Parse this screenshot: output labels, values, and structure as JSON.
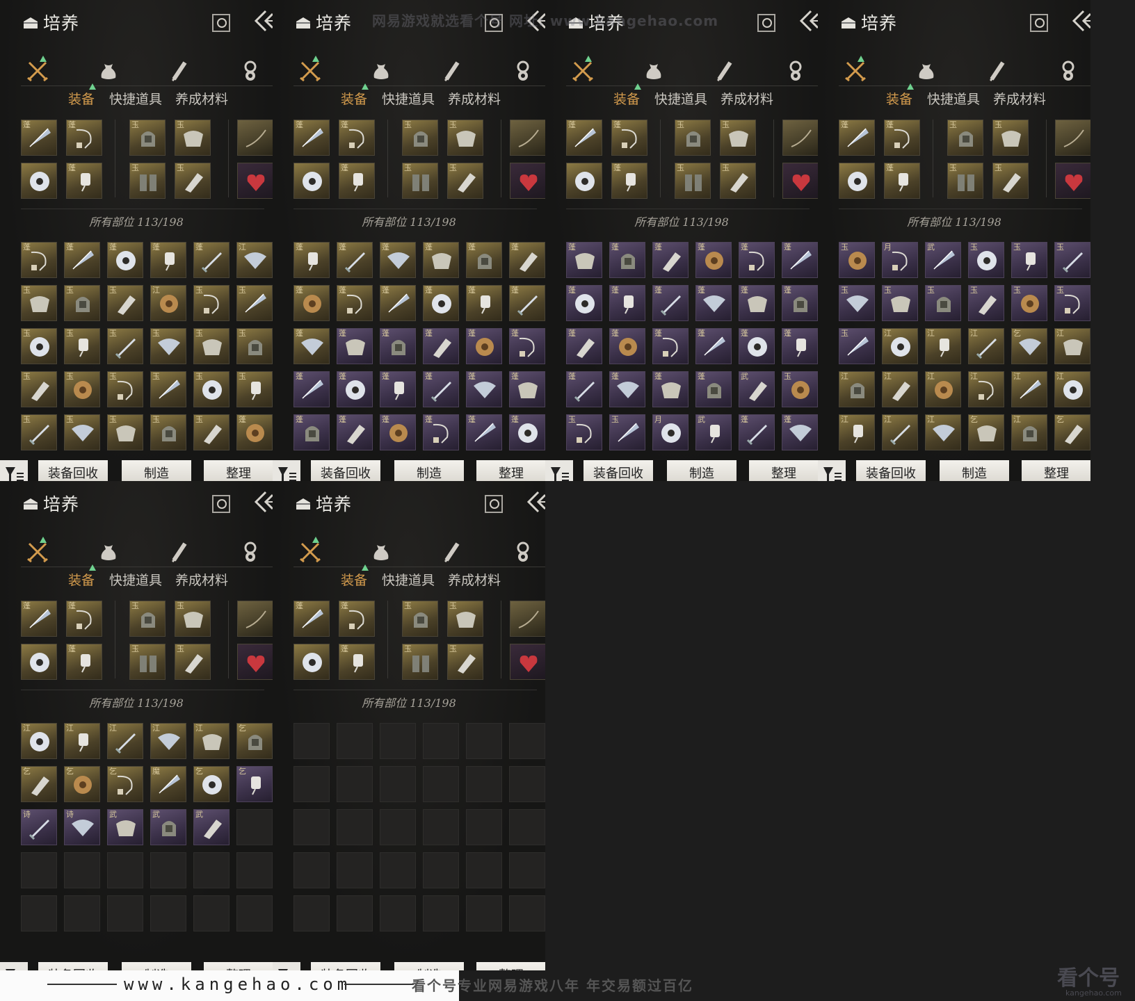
{
  "panel_title": "培养",
  "tabs": [
    {
      "label": "装备",
      "active": true
    },
    {
      "label": "快捷道具",
      "active": false
    },
    {
      "label": "养成材料",
      "active": false
    }
  ],
  "category_icons": [
    "crossed-swords-icon",
    "pouch-icon",
    "scroll-icon",
    "gem-icon"
  ],
  "equipped_slots": [
    {
      "badge": "蓬",
      "item": "umbrella"
    },
    {
      "badge": "蓬",
      "item": "pendant"
    },
    {
      "badge": "玉",
      "item": "helmet"
    },
    {
      "badge": "玉",
      "item": "armor"
    },
    {
      "badge": "",
      "item": "bow"
    },
    {
      "badge": "",
      "item": "ring"
    },
    {
      "badge": "蓬",
      "item": "charm"
    },
    {
      "badge": "玉",
      "item": "greaves"
    },
    {
      "badge": "玉",
      "item": "bracer"
    },
    {
      "badge": "",
      "item": "heart"
    }
  ],
  "count_label": "所有部位 113/198",
  "buttons": {
    "recycle": "装备回收",
    "craft": "制造",
    "sort": "整理"
  },
  "panels": [
    {
      "grid": [
        "g",
        "g",
        "g",
        "g",
        "g",
        "g",
        "g",
        "g",
        "g",
        "g",
        "g",
        "g",
        "g",
        "g",
        "g",
        "g",
        "g",
        "g",
        "g",
        "g",
        "g",
        "g",
        "g",
        "g",
        "g",
        "g",
        "g",
        "g",
        "g",
        "g"
      ],
      "badges": "蓬蓬蓬蓬蓬江玉玉玉江玉玉玉玉玉玉玉玉玉玉玉玉玉玉玉玉玉玉玉蓬"
    },
    {
      "grid": [
        "g",
        "g",
        "g",
        "g",
        "g",
        "g",
        "g",
        "g",
        "g",
        "g",
        "g",
        "g",
        "g",
        "p",
        "p",
        "p",
        "p",
        "p",
        "p",
        "p",
        "p",
        "p",
        "p",
        "p",
        "p",
        "p",
        "p",
        "p",
        "p",
        "p"
      ],
      "badges": "蓬蓬蓬蓬蓬蓬蓬蓬蓬蓬蓬蓬蓬蓬蓬蓬蓬蓬蓬蓬蓬蓬蓬蓬蓬蓬蓬蓬蓬蓬"
    },
    {
      "grid": [
        "p",
        "p",
        "p",
        "p",
        "p",
        "p",
        "p",
        "p",
        "p",
        "p",
        "p",
        "p",
        "p",
        "p",
        "p",
        "p",
        "p",
        "p",
        "p",
        "p",
        "p",
        "p",
        "p",
        "p",
        "p",
        "p",
        "p",
        "p",
        "p",
        "p"
      ],
      "badges": "蓬蓬蓬蓬蓬蓬蓬蓬蓬蓬蓬蓬蓬蓬蓬蓬蓬蓬蓬蓬蓬蓬武玉玉玉月武蓬蓬"
    },
    {
      "grid": [
        "p",
        "p",
        "p",
        "p",
        "p",
        "p",
        "p",
        "p",
        "p",
        "p",
        "p",
        "p",
        "p",
        "g",
        "g",
        "g",
        "g",
        "g",
        "g",
        "g",
        "g",
        "g",
        "g",
        "g",
        "g",
        "g",
        "g",
        "g",
        "g",
        "g"
      ],
      "badges": "玉月武玉玉玉玉玉玉玉玉玉玉江江江乞江江江江江江江江江江乞江乞"
    },
    {
      "grid": [
        "g",
        "g",
        "g",
        "g",
        "g",
        "g",
        "g",
        "g",
        "g",
        "g",
        "g",
        "p",
        "p",
        "p",
        "p",
        "p",
        "p",
        "e",
        "e",
        "e",
        "e",
        "e",
        "e",
        "e",
        "e",
        "e",
        "e",
        "e",
        "e",
        "e"
      ],
      "badges": "江江江江江乞乞乞乞魔乞乞诗诗武武武"
    },
    {
      "grid": [
        "e",
        "e",
        "e",
        "e",
        "e",
        "e",
        "e",
        "e",
        "e",
        "e",
        "e",
        "e",
        "e",
        "e",
        "e",
        "e",
        "e",
        "e",
        "e",
        "e",
        "e",
        "e",
        "e",
        "e",
        "e",
        "e",
        "e",
        "e",
        "e",
        "e"
      ],
      "badges": ""
    }
  ],
  "watermark": {
    "url": "www.kangehao.com",
    "slogan": "看个号专业网易游戏八年 年交易额过百亿",
    "top": "网易游戏就选看个号 网址: www.kangehao.com",
    "brand": "看个号",
    "brand_sub": "kangehao.com"
  }
}
